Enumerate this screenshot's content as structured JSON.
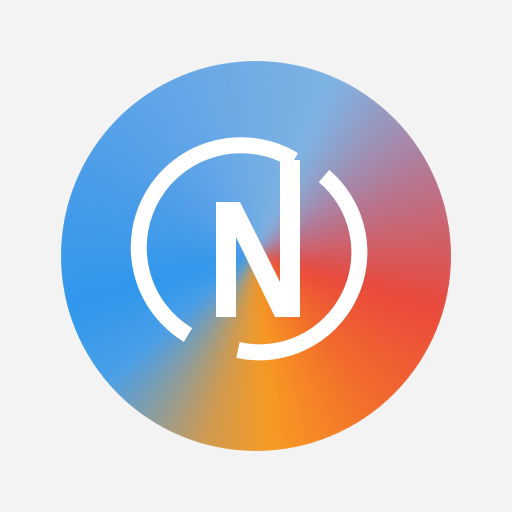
{
  "app_icon": {
    "name": "n-logo-icon",
    "glyph_color": "#ffffff",
    "gradient_colors": [
      "#7fb2e2",
      "#e9493d",
      "#f79a22",
      "#2f97ec"
    ],
    "background_color": "#f3f3f3"
  }
}
